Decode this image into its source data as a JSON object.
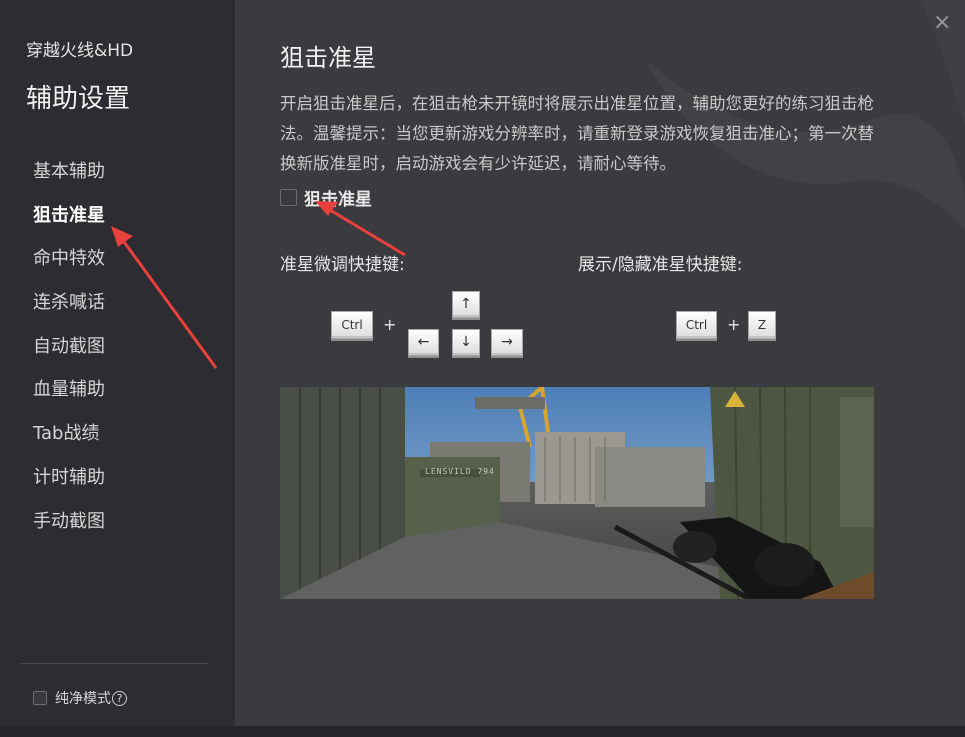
{
  "sidebar": {
    "game_title": "穿越火线&HD",
    "section_title": "辅助设置",
    "items": [
      {
        "label": "基本辅助"
      },
      {
        "label": "狙击准星"
      },
      {
        "label": "命中特效"
      },
      {
        "label": "连杀喊话"
      },
      {
        "label": "自动截图"
      },
      {
        "label": "血量辅助"
      },
      {
        "label": "Tab战绩"
      },
      {
        "label": "计时辅助"
      },
      {
        "label": "手动截图"
      }
    ],
    "active_index": 1,
    "pure_mode_label": "纯净模式",
    "help_icon_glyph": "?"
  },
  "window": {
    "close_glyph": "×"
  },
  "main": {
    "title": "狙击准星",
    "description": "开启狙击准星后，在狙击枪未开镜时将展示出准星位置，辅助您更好的练习狙击枪法。温馨提示：当您更新游戏分辨率时，请重新登录游戏恢复狙击准心；第一次替换新版准星时，启动游戏会有少许延迟，请耐心等待。",
    "enable_label": "狙击准星",
    "enable_checked": false,
    "adjust_label": "准星微调快捷键:",
    "toggle_label": "展示/隐藏准星快捷键:",
    "adjust_keys": {
      "modifier": "Ctrl",
      "plus": "+",
      "up": "↑",
      "left": "←",
      "down": "↓",
      "right": "→"
    },
    "toggle_keys": {
      "modifier": "Ctrl",
      "plus": "+",
      "key": "Z"
    },
    "preview_sign_text": "LENSVILD 794"
  },
  "colors": {
    "sidebar_bg": "#2d2d31",
    "main_bg": "#3b3b3f",
    "annotation_arrow": "#e8403c"
  },
  "icons": {
    "close": "close-icon",
    "help": "help-icon",
    "checkbox": "checkbox-icon"
  }
}
